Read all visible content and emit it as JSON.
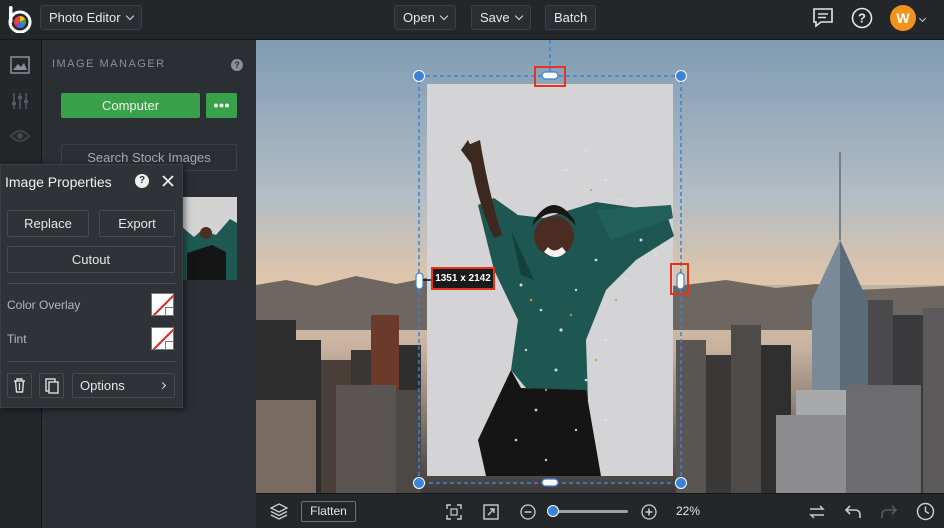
{
  "topbar": {
    "app_menu": "Photo Editor",
    "open": "Open",
    "save": "Save",
    "batch": "Batch",
    "avatar_initial": "W"
  },
  "panel": {
    "title": "IMAGE MANAGER",
    "computer_button": "Computer",
    "search_stock": "Search Stock Images"
  },
  "properties": {
    "title": "Image Properties",
    "replace": "Replace",
    "export": "Export",
    "cutout": "Cutout",
    "color_overlay": "Color Overlay",
    "tint": "Tint",
    "options": "Options"
  },
  "canvas": {
    "dimension_label": "1351 x 2142"
  },
  "bottombar": {
    "flatten": "Flatten",
    "zoom": "22%",
    "zoom_value": 0.22
  },
  "colors": {
    "accent_green": "#3aa14b",
    "selection_blue": "#3b82d9",
    "highlight_red": "#e5341c",
    "avatar_orange": "#f0931e"
  }
}
